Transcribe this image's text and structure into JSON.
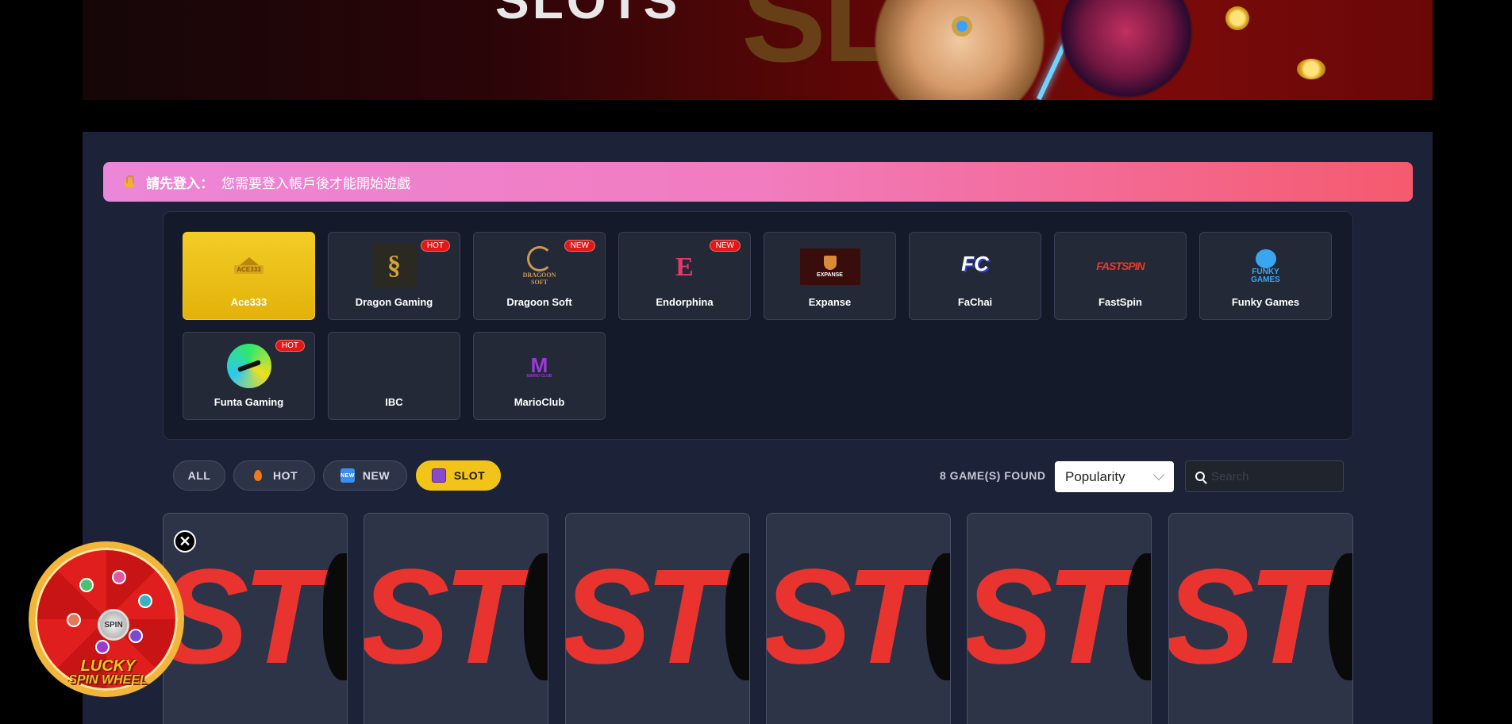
{
  "banner": {
    "title": "SLOTS",
    "big_text": "SLO"
  },
  "login_notice": {
    "label": "請先登入：",
    "message": "您需要登入帳戶後才能開始遊戲"
  },
  "providers": [
    {
      "name": "Ace333",
      "logo": "ACE333",
      "badge": ""
    },
    {
      "name": "Dragon Gaming",
      "logo": "",
      "badge": "HOT"
    },
    {
      "name": "Dragoon Soft",
      "logo": "DRAGOON SOFT",
      "badge": "NEW"
    },
    {
      "name": "Endorphina",
      "logo": "E",
      "badge": "NEW"
    },
    {
      "name": "Expanse",
      "logo": "EXPANSE",
      "badge": ""
    },
    {
      "name": "FaChai",
      "logo": "FC",
      "badge": ""
    },
    {
      "name": "FastSpin",
      "logo": "FASTSPIN",
      "badge": ""
    },
    {
      "name": "Funky Games",
      "logo": "FUNKY GAMES",
      "badge": ""
    },
    {
      "name": "Funta Gaming",
      "logo": "",
      "badge": "HOT"
    },
    {
      "name": "IBC",
      "logo": "",
      "badge": ""
    },
    {
      "name": "MarioClub",
      "logo": "MARIO CLUB",
      "badge": ""
    }
  ],
  "filters": [
    {
      "label": "ALL",
      "icon": ""
    },
    {
      "label": "HOT",
      "icon": "flame-icon"
    },
    {
      "label": "NEW",
      "icon": "new-icon"
    },
    {
      "label": "SLOT",
      "icon": "slot-machine-icon"
    }
  ],
  "results": {
    "count_text": "8 GAME(S) FOUND"
  },
  "sort": {
    "selected": "Popularity"
  },
  "search": {
    "placeholder": "Search"
  },
  "games": [
    {
      "art_text": "ST"
    },
    {
      "art_text": "ST"
    },
    {
      "art_text": "ST"
    },
    {
      "art_text": "ST"
    },
    {
      "art_text": "ST"
    },
    {
      "art_text": "ST"
    }
  ],
  "spin_wheel": {
    "title_line1": "LUCKY",
    "title_line2": "SPIN WHEEL",
    "hub": "SPIN",
    "close": "✕"
  },
  "colors": {
    "accent": "#f2c318",
    "badge": "#e01818",
    "panel": "#1c2237"
  }
}
